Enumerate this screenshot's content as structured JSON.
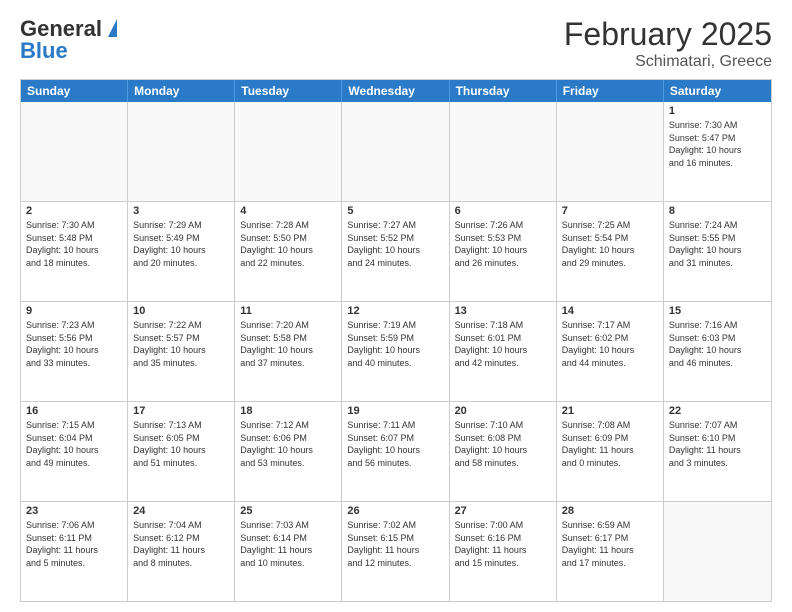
{
  "logo": {
    "line1": "General",
    "line2": "Blue"
  },
  "title": "February 2025",
  "subtitle": "Schimatari, Greece",
  "headers": [
    "Sunday",
    "Monday",
    "Tuesday",
    "Wednesday",
    "Thursday",
    "Friday",
    "Saturday"
  ],
  "weeks": [
    [
      {
        "day": "",
        "info": ""
      },
      {
        "day": "",
        "info": ""
      },
      {
        "day": "",
        "info": ""
      },
      {
        "day": "",
        "info": ""
      },
      {
        "day": "",
        "info": ""
      },
      {
        "day": "",
        "info": ""
      },
      {
        "day": "1",
        "info": "Sunrise: 7:30 AM\nSunset: 5:47 PM\nDaylight: 10 hours\nand 16 minutes."
      }
    ],
    [
      {
        "day": "2",
        "info": "Sunrise: 7:30 AM\nSunset: 5:48 PM\nDaylight: 10 hours\nand 18 minutes."
      },
      {
        "day": "3",
        "info": "Sunrise: 7:29 AM\nSunset: 5:49 PM\nDaylight: 10 hours\nand 20 minutes."
      },
      {
        "day": "4",
        "info": "Sunrise: 7:28 AM\nSunset: 5:50 PM\nDaylight: 10 hours\nand 22 minutes."
      },
      {
        "day": "5",
        "info": "Sunrise: 7:27 AM\nSunset: 5:52 PM\nDaylight: 10 hours\nand 24 minutes."
      },
      {
        "day": "6",
        "info": "Sunrise: 7:26 AM\nSunset: 5:53 PM\nDaylight: 10 hours\nand 26 minutes."
      },
      {
        "day": "7",
        "info": "Sunrise: 7:25 AM\nSunset: 5:54 PM\nDaylight: 10 hours\nand 29 minutes."
      },
      {
        "day": "8",
        "info": "Sunrise: 7:24 AM\nSunset: 5:55 PM\nDaylight: 10 hours\nand 31 minutes."
      }
    ],
    [
      {
        "day": "9",
        "info": "Sunrise: 7:23 AM\nSunset: 5:56 PM\nDaylight: 10 hours\nand 33 minutes."
      },
      {
        "day": "10",
        "info": "Sunrise: 7:22 AM\nSunset: 5:57 PM\nDaylight: 10 hours\nand 35 minutes."
      },
      {
        "day": "11",
        "info": "Sunrise: 7:20 AM\nSunset: 5:58 PM\nDaylight: 10 hours\nand 37 minutes."
      },
      {
        "day": "12",
        "info": "Sunrise: 7:19 AM\nSunset: 5:59 PM\nDaylight: 10 hours\nand 40 minutes."
      },
      {
        "day": "13",
        "info": "Sunrise: 7:18 AM\nSunset: 6:01 PM\nDaylight: 10 hours\nand 42 minutes."
      },
      {
        "day": "14",
        "info": "Sunrise: 7:17 AM\nSunset: 6:02 PM\nDaylight: 10 hours\nand 44 minutes."
      },
      {
        "day": "15",
        "info": "Sunrise: 7:16 AM\nSunset: 6:03 PM\nDaylight: 10 hours\nand 46 minutes."
      }
    ],
    [
      {
        "day": "16",
        "info": "Sunrise: 7:15 AM\nSunset: 6:04 PM\nDaylight: 10 hours\nand 49 minutes."
      },
      {
        "day": "17",
        "info": "Sunrise: 7:13 AM\nSunset: 6:05 PM\nDaylight: 10 hours\nand 51 minutes."
      },
      {
        "day": "18",
        "info": "Sunrise: 7:12 AM\nSunset: 6:06 PM\nDaylight: 10 hours\nand 53 minutes."
      },
      {
        "day": "19",
        "info": "Sunrise: 7:11 AM\nSunset: 6:07 PM\nDaylight: 10 hours\nand 56 minutes."
      },
      {
        "day": "20",
        "info": "Sunrise: 7:10 AM\nSunset: 6:08 PM\nDaylight: 10 hours\nand 58 minutes."
      },
      {
        "day": "21",
        "info": "Sunrise: 7:08 AM\nSunset: 6:09 PM\nDaylight: 11 hours\nand 0 minutes."
      },
      {
        "day": "22",
        "info": "Sunrise: 7:07 AM\nSunset: 6:10 PM\nDaylight: 11 hours\nand 3 minutes."
      }
    ],
    [
      {
        "day": "23",
        "info": "Sunrise: 7:06 AM\nSunset: 6:11 PM\nDaylight: 11 hours\nand 5 minutes."
      },
      {
        "day": "24",
        "info": "Sunrise: 7:04 AM\nSunset: 6:12 PM\nDaylight: 11 hours\nand 8 minutes."
      },
      {
        "day": "25",
        "info": "Sunrise: 7:03 AM\nSunset: 6:14 PM\nDaylight: 11 hours\nand 10 minutes."
      },
      {
        "day": "26",
        "info": "Sunrise: 7:02 AM\nSunset: 6:15 PM\nDaylight: 11 hours\nand 12 minutes."
      },
      {
        "day": "27",
        "info": "Sunrise: 7:00 AM\nSunset: 6:16 PM\nDaylight: 11 hours\nand 15 minutes."
      },
      {
        "day": "28",
        "info": "Sunrise: 6:59 AM\nSunset: 6:17 PM\nDaylight: 11 hours\nand 17 minutes."
      },
      {
        "day": "",
        "info": ""
      }
    ]
  ]
}
